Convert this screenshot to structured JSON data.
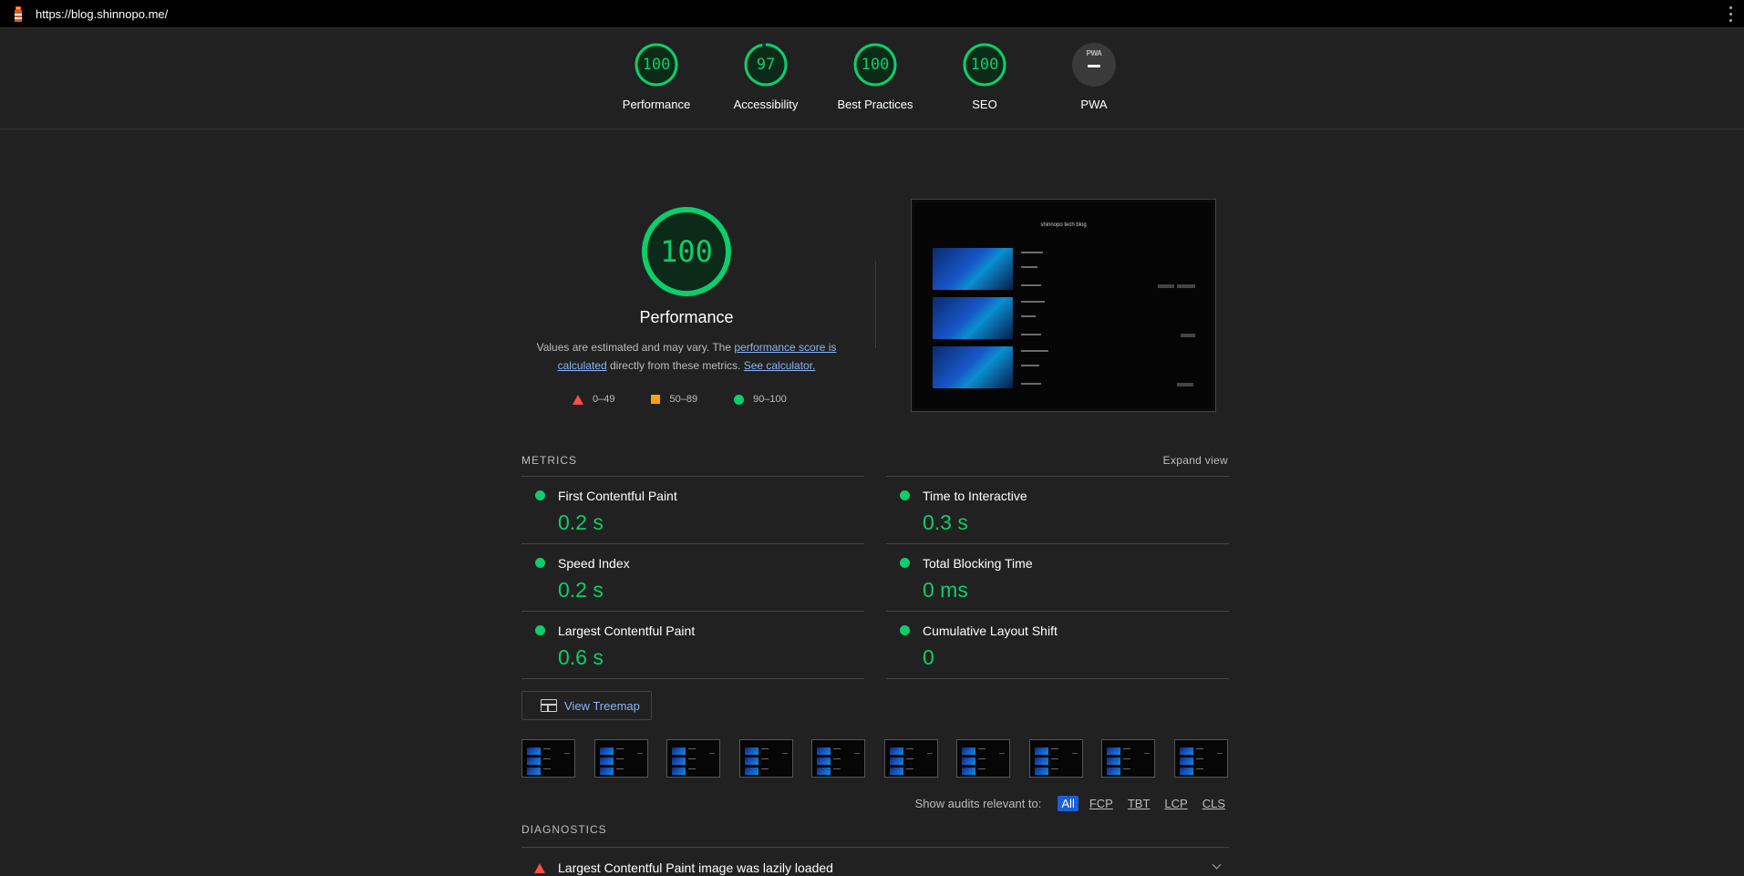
{
  "topbar": {
    "url": "https://blog.shinnopo.me/"
  },
  "categories": [
    {
      "score": "100",
      "label": "Performance"
    },
    {
      "score": "97",
      "label": "Accessibility"
    },
    {
      "score": "100",
      "label": "Best Practices"
    },
    {
      "score": "100",
      "label": "SEO"
    },
    {
      "badge": "PWA",
      "label": "PWA"
    }
  ],
  "performance": {
    "score": "100",
    "title": "Performance",
    "desc_before": "Values are estimated and may vary. The ",
    "desc_link1": "performance score is calculated",
    "desc_mid": " directly from these metrics. ",
    "desc_link2": "See calculator.",
    "legend": {
      "fail": "0–49",
      "average": "50–89",
      "pass": "90–100"
    }
  },
  "screenshot": {
    "site_title": "shinnopo tech blog",
    "posts": [
      {
        "title": "hugo",
        "summary": "",
        "date": ""
      },
      {
        "title": "Hello world",
        "summary": "",
        "date": ""
      },
      {
        "title": "",
        "summary": "",
        "date": ""
      }
    ]
  },
  "metrics": {
    "heading": "METRICS",
    "expand": "Expand view",
    "items": [
      {
        "name": "First Contentful Paint",
        "value": "0.2 s"
      },
      {
        "name": "Time to Interactive",
        "value": "0.3 s"
      },
      {
        "name": "Speed Index",
        "value": "0.2 s"
      },
      {
        "name": "Total Blocking Time",
        "value": "0 ms"
      },
      {
        "name": "Largest Contentful Paint",
        "value": "0.6 s"
      },
      {
        "name": "Cumulative Layout Shift",
        "value": "0"
      }
    ]
  },
  "treemap": {
    "label": "View Treemap"
  },
  "audit_filter": {
    "label": "Show audits relevant to:",
    "chips": [
      "All",
      "FCP",
      "TBT",
      "LCP",
      "CLS"
    ],
    "active": "All"
  },
  "diagnostics": {
    "heading": "DIAGNOSTICS",
    "items": [
      {
        "title": "Largest Contentful Paint image was lazily loaded",
        "status": "fail"
      }
    ]
  },
  "colors": {
    "pass": "#0cce6b",
    "average": "#ffa400",
    "fail": "#ff4e42",
    "link": "#8ab4f8",
    "active_chip": "#1a5fd8"
  }
}
